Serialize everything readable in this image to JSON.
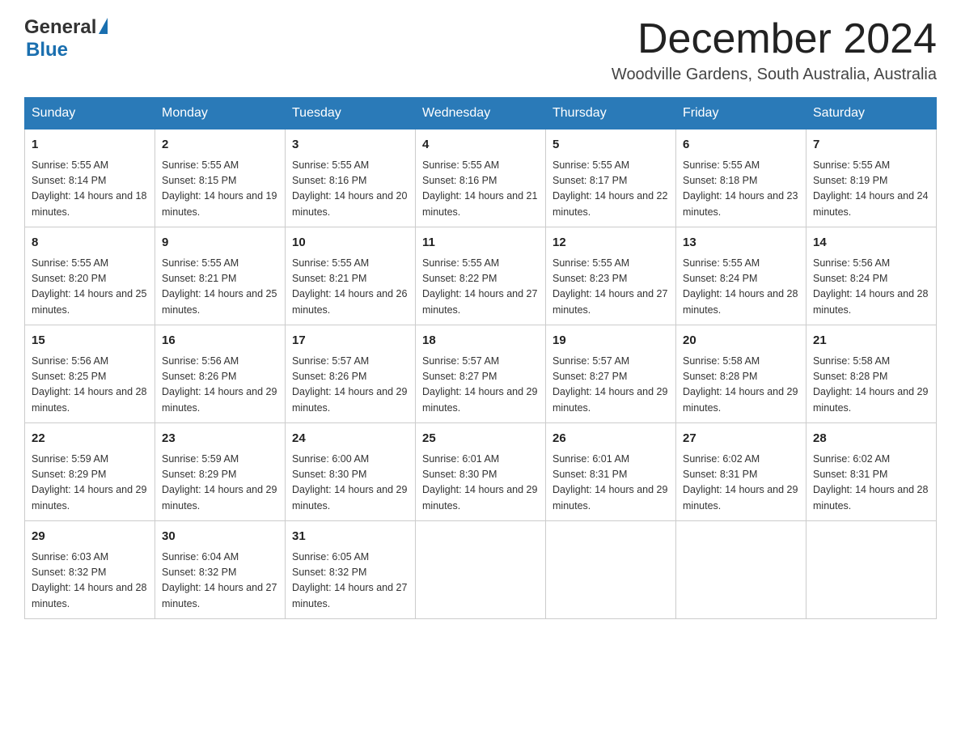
{
  "logo": {
    "general": "General",
    "blue": "Blue"
  },
  "title": "December 2024",
  "location": "Woodville Gardens, South Australia, Australia",
  "days_of_week": [
    "Sunday",
    "Monday",
    "Tuesday",
    "Wednesday",
    "Thursday",
    "Friday",
    "Saturday"
  ],
  "weeks": [
    [
      {
        "day": "1",
        "sunrise": "Sunrise: 5:55 AM",
        "sunset": "Sunset: 8:14 PM",
        "daylight": "Daylight: 14 hours and 18 minutes."
      },
      {
        "day": "2",
        "sunrise": "Sunrise: 5:55 AM",
        "sunset": "Sunset: 8:15 PM",
        "daylight": "Daylight: 14 hours and 19 minutes."
      },
      {
        "day": "3",
        "sunrise": "Sunrise: 5:55 AM",
        "sunset": "Sunset: 8:16 PM",
        "daylight": "Daylight: 14 hours and 20 minutes."
      },
      {
        "day": "4",
        "sunrise": "Sunrise: 5:55 AM",
        "sunset": "Sunset: 8:16 PM",
        "daylight": "Daylight: 14 hours and 21 minutes."
      },
      {
        "day": "5",
        "sunrise": "Sunrise: 5:55 AM",
        "sunset": "Sunset: 8:17 PM",
        "daylight": "Daylight: 14 hours and 22 minutes."
      },
      {
        "day": "6",
        "sunrise": "Sunrise: 5:55 AM",
        "sunset": "Sunset: 8:18 PM",
        "daylight": "Daylight: 14 hours and 23 minutes."
      },
      {
        "day": "7",
        "sunrise": "Sunrise: 5:55 AM",
        "sunset": "Sunset: 8:19 PM",
        "daylight": "Daylight: 14 hours and 24 minutes."
      }
    ],
    [
      {
        "day": "8",
        "sunrise": "Sunrise: 5:55 AM",
        "sunset": "Sunset: 8:20 PM",
        "daylight": "Daylight: 14 hours and 25 minutes."
      },
      {
        "day": "9",
        "sunrise": "Sunrise: 5:55 AM",
        "sunset": "Sunset: 8:21 PM",
        "daylight": "Daylight: 14 hours and 25 minutes."
      },
      {
        "day": "10",
        "sunrise": "Sunrise: 5:55 AM",
        "sunset": "Sunset: 8:21 PM",
        "daylight": "Daylight: 14 hours and 26 minutes."
      },
      {
        "day": "11",
        "sunrise": "Sunrise: 5:55 AM",
        "sunset": "Sunset: 8:22 PM",
        "daylight": "Daylight: 14 hours and 27 minutes."
      },
      {
        "day": "12",
        "sunrise": "Sunrise: 5:55 AM",
        "sunset": "Sunset: 8:23 PM",
        "daylight": "Daylight: 14 hours and 27 minutes."
      },
      {
        "day": "13",
        "sunrise": "Sunrise: 5:55 AM",
        "sunset": "Sunset: 8:24 PM",
        "daylight": "Daylight: 14 hours and 28 minutes."
      },
      {
        "day": "14",
        "sunrise": "Sunrise: 5:56 AM",
        "sunset": "Sunset: 8:24 PM",
        "daylight": "Daylight: 14 hours and 28 minutes."
      }
    ],
    [
      {
        "day": "15",
        "sunrise": "Sunrise: 5:56 AM",
        "sunset": "Sunset: 8:25 PM",
        "daylight": "Daylight: 14 hours and 28 minutes."
      },
      {
        "day": "16",
        "sunrise": "Sunrise: 5:56 AM",
        "sunset": "Sunset: 8:26 PM",
        "daylight": "Daylight: 14 hours and 29 minutes."
      },
      {
        "day": "17",
        "sunrise": "Sunrise: 5:57 AM",
        "sunset": "Sunset: 8:26 PM",
        "daylight": "Daylight: 14 hours and 29 minutes."
      },
      {
        "day": "18",
        "sunrise": "Sunrise: 5:57 AM",
        "sunset": "Sunset: 8:27 PM",
        "daylight": "Daylight: 14 hours and 29 minutes."
      },
      {
        "day": "19",
        "sunrise": "Sunrise: 5:57 AM",
        "sunset": "Sunset: 8:27 PM",
        "daylight": "Daylight: 14 hours and 29 minutes."
      },
      {
        "day": "20",
        "sunrise": "Sunrise: 5:58 AM",
        "sunset": "Sunset: 8:28 PM",
        "daylight": "Daylight: 14 hours and 29 minutes."
      },
      {
        "day": "21",
        "sunrise": "Sunrise: 5:58 AM",
        "sunset": "Sunset: 8:28 PM",
        "daylight": "Daylight: 14 hours and 29 minutes."
      }
    ],
    [
      {
        "day": "22",
        "sunrise": "Sunrise: 5:59 AM",
        "sunset": "Sunset: 8:29 PM",
        "daylight": "Daylight: 14 hours and 29 minutes."
      },
      {
        "day": "23",
        "sunrise": "Sunrise: 5:59 AM",
        "sunset": "Sunset: 8:29 PM",
        "daylight": "Daylight: 14 hours and 29 minutes."
      },
      {
        "day": "24",
        "sunrise": "Sunrise: 6:00 AM",
        "sunset": "Sunset: 8:30 PM",
        "daylight": "Daylight: 14 hours and 29 minutes."
      },
      {
        "day": "25",
        "sunrise": "Sunrise: 6:01 AM",
        "sunset": "Sunset: 8:30 PM",
        "daylight": "Daylight: 14 hours and 29 minutes."
      },
      {
        "day": "26",
        "sunrise": "Sunrise: 6:01 AM",
        "sunset": "Sunset: 8:31 PM",
        "daylight": "Daylight: 14 hours and 29 minutes."
      },
      {
        "day": "27",
        "sunrise": "Sunrise: 6:02 AM",
        "sunset": "Sunset: 8:31 PM",
        "daylight": "Daylight: 14 hours and 29 minutes."
      },
      {
        "day": "28",
        "sunrise": "Sunrise: 6:02 AM",
        "sunset": "Sunset: 8:31 PM",
        "daylight": "Daylight: 14 hours and 28 minutes."
      }
    ],
    [
      {
        "day": "29",
        "sunrise": "Sunrise: 6:03 AM",
        "sunset": "Sunset: 8:32 PM",
        "daylight": "Daylight: 14 hours and 28 minutes."
      },
      {
        "day": "30",
        "sunrise": "Sunrise: 6:04 AM",
        "sunset": "Sunset: 8:32 PM",
        "daylight": "Daylight: 14 hours and 27 minutes."
      },
      {
        "day": "31",
        "sunrise": "Sunrise: 6:05 AM",
        "sunset": "Sunset: 8:32 PM",
        "daylight": "Daylight: 14 hours and 27 minutes."
      },
      null,
      null,
      null,
      null
    ]
  ]
}
